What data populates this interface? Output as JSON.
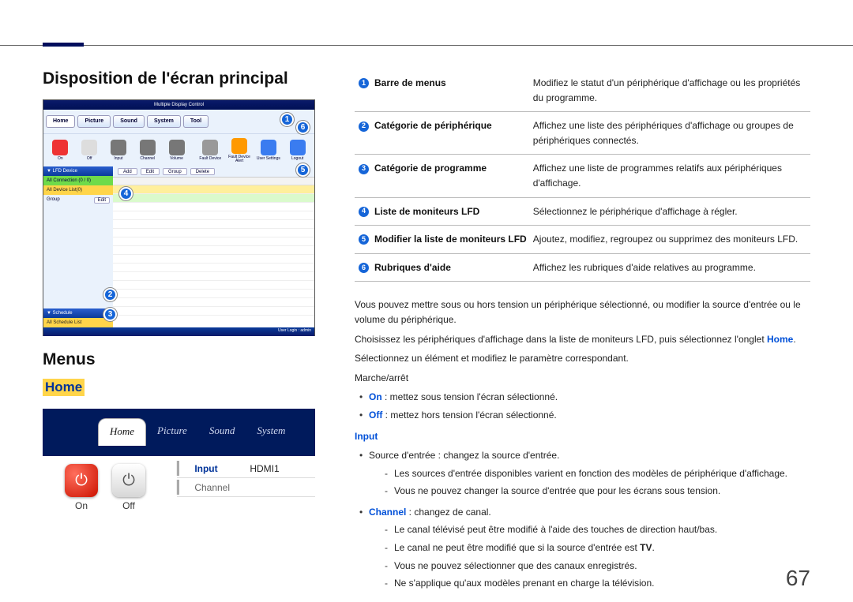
{
  "heading1": "Disposition de l'écran principal",
  "heading2": "Menus",
  "home_label": "Home",
  "page_number": "67",
  "shot1": {
    "title": "Multiple Display Control",
    "menutabs": [
      "Home",
      "Picture",
      "Sound",
      "System",
      "Tool"
    ],
    "toolbar": [
      {
        "label": "On"
      },
      {
        "label": "Off"
      },
      {
        "label": "Input"
      },
      {
        "label": "Channel"
      },
      {
        "label": "Volume"
      },
      {
        "label": "Fault Device"
      },
      {
        "label": "Fault Device Alert"
      },
      {
        "label": "User Settings"
      },
      {
        "label": "Logout"
      }
    ],
    "subbar": [
      "Add",
      "Edit",
      "Group",
      "Delete"
    ],
    "side": {
      "hdr1": "▼ LFD Device",
      "row_all": "All Connection (0 / 0)",
      "row_list": "All Device List(0)",
      "row_group": "Group",
      "row_edit": "Edit",
      "hdr2": "▼ Schedule",
      "row_sched": "All Schedule List"
    },
    "footer": "User Login : admin"
  },
  "shot2": {
    "tabs": [
      "Home",
      "Picture",
      "Sound",
      "System"
    ],
    "on": "On",
    "off": "Off",
    "input_lab": "Input",
    "input_val": "HDMI1",
    "channel_lab": "Channel",
    "channel_val": ""
  },
  "table": [
    {
      "n": "1",
      "label": "Barre de menus",
      "desc": "Modifiez le statut d'un périphérique d'affichage ou les propriétés du programme."
    },
    {
      "n": "2",
      "label": "Catégorie de périphérique",
      "desc": "Affichez une liste des périphériques d'affichage ou groupes de périphériques connectés."
    },
    {
      "n": "3",
      "label": "Catégorie de programme",
      "desc": "Affichez une liste de programmes relatifs aux périphériques d'affichage."
    },
    {
      "n": "4",
      "label": "Liste de moniteurs LFD",
      "desc": "Sélectionnez le périphérique d'affichage à régler."
    },
    {
      "n": "5",
      "label": "Modifier la liste de moniteurs LFD",
      "desc": "Ajoutez, modifiez, regroupez ou supprimez des moniteurs LFD."
    },
    {
      "n": "6",
      "label": "Rubriques d'aide",
      "desc": "Affichez les rubriques d'aide relatives au programme."
    }
  ],
  "body": {
    "p1": "Vous pouvez mettre sous ou hors tension un périphérique sélectionné, ou modifier la source d'entrée ou le volume du périphérique.",
    "p2a": "Choisissez les périphériques d'affichage dans la liste de moniteurs LFD, puis sélectionnez l'onglet ",
    "p2b": "Home",
    "p2c": ".",
    "p3": "Sélectionnez un élément et modifiez le paramètre correspondant.",
    "p4": "Marche/arrêt",
    "on_b": "On",
    "on_t": " : mettez sous tension l'écran sélectionné.",
    "off_b": "Off",
    "off_t": " : mettez hors tension l'écran sélectionné.",
    "input_h": "Input",
    "src_li": "Source d'entrée : changez la source d'entrée.",
    "src_s1": "Les sources d'entrée disponibles varient en fonction des modèles de périphérique d'affichage.",
    "src_s2": "Vous ne pouvez changer la source d'entrée que pour les écrans sous tension.",
    "ch_b": "Channel",
    "ch_t": " : changez de canal.",
    "ch_s1": "Le canal télévisé peut être modifié à l'aide des touches de direction haut/bas.",
    "ch_s2a": "Le canal ne peut être modifié que si la source d'entrée est ",
    "ch_s2b": "TV",
    "ch_s2c": ".",
    "ch_s3": "Vous ne pouvez sélectionner que des canaux enregistrés.",
    "ch_s4": "Ne s'applique qu'aux modèles prenant en charge la télévision."
  }
}
